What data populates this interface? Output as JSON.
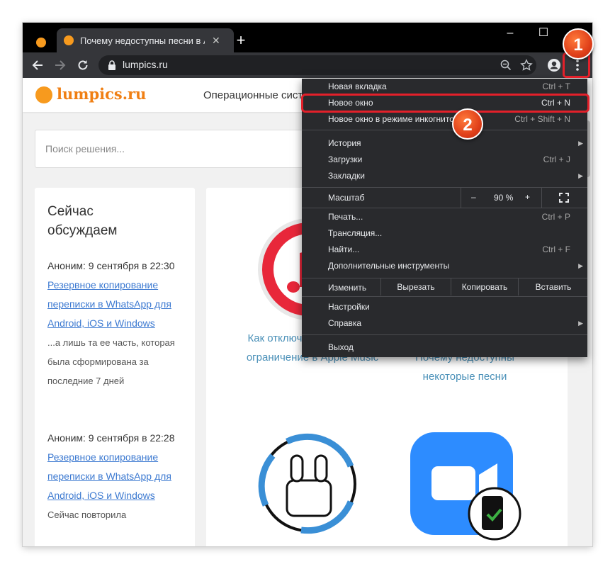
{
  "browser": {
    "tab_title": "Почему недоступны песни в Apple",
    "new_tab_symbol": "+",
    "url": "lumpics.ru",
    "window_controls": {
      "minimize": "–",
      "maximize": "☐"
    }
  },
  "site": {
    "logo_text": "lumpics.ru",
    "nav_text": "Операционные систем",
    "search_placeholder": "Поиск решения...",
    "aside_title": "Сейчас обсуждаем",
    "comments": [
      {
        "author_date": "Аноним: 9 сентября в 22:30",
        "link": "Резервное копирование переписки в WhatsApp для Android, iOS и Windows",
        "snippet": "...а лишь та ее часть, которая была сформирована за последние 7 дней"
      },
      {
        "author_date": "Аноним: 9 сентября в 22:28",
        "link": "Резервное копирование переписки в WhatsApp для Android, iOS и Windows",
        "snippet": "Сейчас повторила"
      }
    ],
    "articles": [
      {
        "title": "Как отключить возрастное ограничение в Apple Music"
      },
      {
        "title": "Почему недоступны некоторые песни"
      }
    ]
  },
  "menu": {
    "items": [
      {
        "label": "Новая вкладка",
        "shortcut": "Ctrl + T"
      },
      {
        "label": "Новое окно",
        "shortcut": "Ctrl + N"
      },
      {
        "label": "Новое окно в режиме инкогнито",
        "shortcut": "Ctrl + Shift + N"
      },
      {
        "label": "История",
        "shortcut": ""
      },
      {
        "label": "Загрузки",
        "shortcut": "Ctrl + J"
      },
      {
        "label": "Закладки",
        "shortcut": ""
      },
      {
        "label": "Печать...",
        "shortcut": "Ctrl + P"
      },
      {
        "label": "Трансляция...",
        "shortcut": ""
      },
      {
        "label": "Найти...",
        "shortcut": "Ctrl + F"
      },
      {
        "label": "Дополнительные инструменты",
        "shortcut": ""
      },
      {
        "label": "Настройки",
        "shortcut": ""
      },
      {
        "label": "Справка",
        "shortcut": ""
      },
      {
        "label": "Выход",
        "shortcut": ""
      }
    ],
    "zoom": {
      "label": "Масштаб",
      "minus": "–",
      "value": "90 %",
      "plus": "+"
    },
    "edit": {
      "label": "Изменить",
      "cut": "Вырезать",
      "copy": "Копировать",
      "paste": "Вставить"
    }
  },
  "annotations": {
    "step1": "1",
    "step2": "2",
    "color": "#e3202a"
  }
}
